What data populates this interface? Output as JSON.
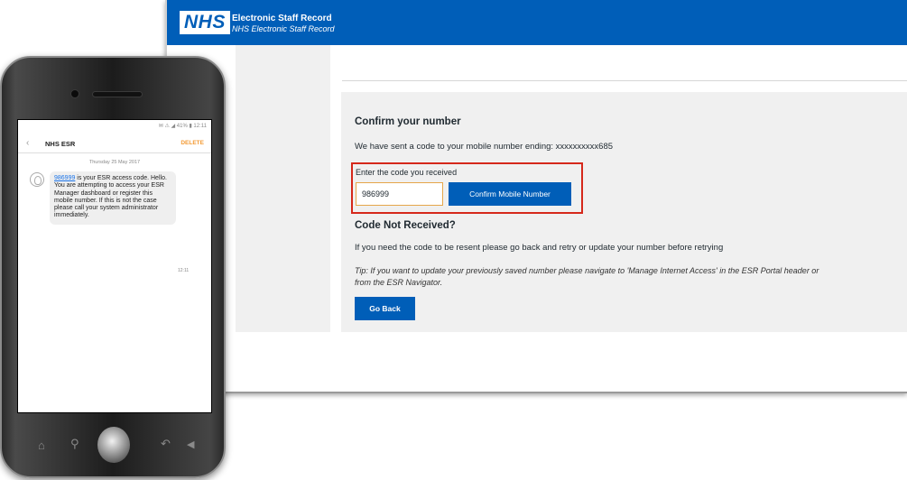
{
  "browser": {
    "header": {
      "logo": "NHS",
      "title": "Electronic Staff Record",
      "subtitle": "NHS Electronic Staff Record"
    },
    "confirm": {
      "heading": "Confirm your number",
      "sent_text": "We have sent a code to your mobile number ending: xxxxxxxxxx685",
      "code_label": "Enter the code you received",
      "code_value": "986999",
      "confirm_button": "Confirm Mobile Number"
    },
    "not_received": {
      "heading": "Code Not Received?",
      "resend_text": "If you need the code to be resent please go back and retry or update your number before retrying",
      "tip": "Tip: If you want to update your previously saved number please navigate to 'Manage Internet Access' in the ESR Portal header or from the ESR Navigator.",
      "go_back_button": "Go Back"
    }
  },
  "phone": {
    "status_bar": "✉ ⚠ ◢ 41% ▮ 12:11",
    "sms": {
      "back_glyph": "‹",
      "contact": "NHS ESR",
      "delete_label": "DELETE",
      "date": "Thursday 25 May 2017",
      "message_code": "986999",
      "message_text": " is your ESR access code. Hello. You are attempting to access your ESR Manager dashboard or register this mobile number. If this is not the case please call your system administrator immediately.",
      "time": "12:11"
    },
    "nav": {
      "home_icon": "⌂",
      "search_icon": "⚲",
      "back_icon": "↶",
      "volume_icon": "◀"
    }
  },
  "colors": {
    "nhs_blue": "#005eb8",
    "highlight_red": "#d5281b",
    "delete_orange": "#f39a34"
  }
}
